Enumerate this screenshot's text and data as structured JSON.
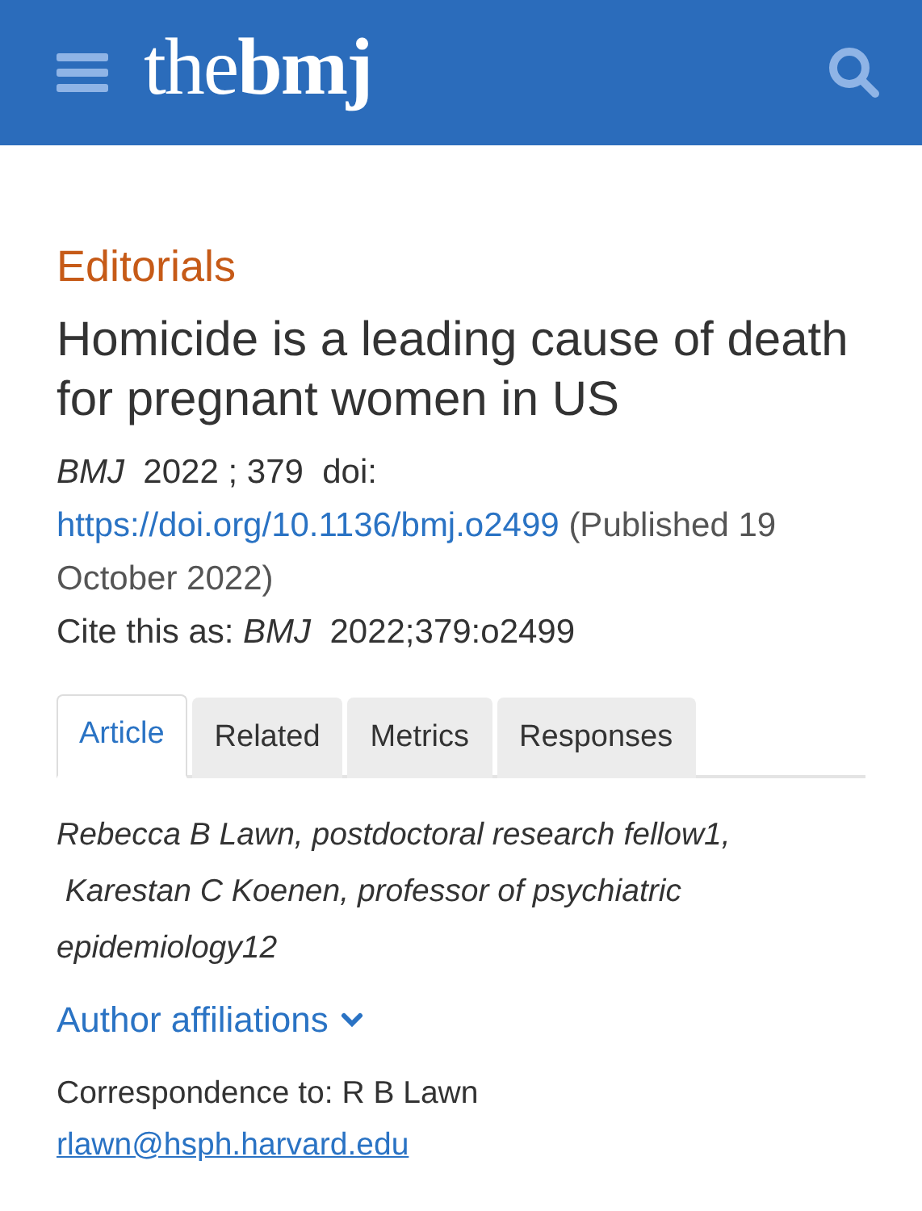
{
  "header": {
    "logo": "the**bmj**"
  },
  "section": "Editorials",
  "title": "Homicide is a leading cause of death for pregnant women in US",
  "citation": {
    "journal_line": "*BMJ*  2022 ; 379  doi:",
    "doi_link": "https://doi.org/10.1136/bmj.o2499",
    "published": "(Published 19 October 2022)"
  },
  "cite_as": "Cite this as: *BMJ*  2022;379:o2499",
  "tabs": [
    {
      "label": "Article",
      "selected": true
    },
    {
      "label": "Related",
      "selected": false
    },
    {
      "label": "Metrics",
      "selected": false
    },
    {
      "label": "Responses",
      "selected": false
    }
  ],
  "authors": [
    "Rebecca B Lawn, postdoctoral research fellow1,",
    "Karestan C Koenen, professor of psychiatric epidemiology12"
  ],
  "affiliations_link": {
    "label": "Author affiliations",
    "expanded": false
  },
  "correspondence": {
    "text": "Correspondence to: R B Lawn",
    "email": "rlawn@hsph.harvard.edu"
  }
}
